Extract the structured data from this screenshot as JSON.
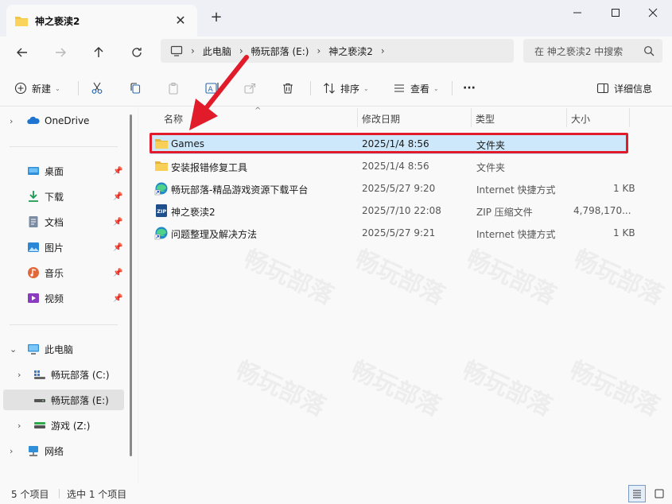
{
  "window": {
    "tab_title": "神之亵渎2",
    "tab_close": "✕",
    "new_tab": "+"
  },
  "navigation": {
    "breadcrumb": [
      "此电脑",
      "畅玩部落 (E:)",
      "神之亵渎2"
    ],
    "search_placeholder": "在 神之亵渎2 中搜索"
  },
  "toolbar": {
    "new_label": "新建",
    "sort_label": "排序",
    "view_label": "查看",
    "more_label": "···",
    "details_label": "详细信息"
  },
  "sidebar": {
    "onedrive": "OneDrive",
    "quick_access": [
      {
        "label": "桌面",
        "icon": "desktop-icon"
      },
      {
        "label": "下载",
        "icon": "download-icon"
      },
      {
        "label": "文档",
        "icon": "document-icon"
      },
      {
        "label": "图片",
        "icon": "pictures-icon"
      },
      {
        "label": "音乐",
        "icon": "music-icon"
      },
      {
        "label": "视频",
        "icon": "video-icon"
      }
    ],
    "this_pc": "此电脑",
    "drives": [
      {
        "label": "畅玩部落 (C:)",
        "icon": "system-drive-icon"
      },
      {
        "label": "畅玩部落 (E:)",
        "icon": "drive-icon"
      },
      {
        "label": "游戏 (Z:)",
        "icon": "drive-icon"
      }
    ],
    "network": "网络"
  },
  "filelist": {
    "columns": {
      "name": "名称",
      "modified": "修改日期",
      "type": "类型",
      "size": "大小"
    },
    "rows": [
      {
        "name": "Games",
        "modified": "2025/1/4 8:56",
        "type": "文件夹",
        "size": "",
        "icon": "folder-icon",
        "selected": true
      },
      {
        "name": "安装报错修复工具",
        "modified": "2025/1/4 8:56",
        "type": "文件夹",
        "size": "",
        "icon": "folder-icon"
      },
      {
        "name": "畅玩部落-精品游戏资源下载平台",
        "modified": "2025/5/27 9:20",
        "type": "Internet 快捷方式",
        "size": "1 KB",
        "icon": "edge-shortcut-icon"
      },
      {
        "name": "神之亵渎2",
        "modified": "2025/7/10 22:08",
        "type": "ZIP 压缩文件",
        "size": "4,798,170...",
        "icon": "zip-icon"
      },
      {
        "name": "问题整理及解决方法",
        "modified": "2025/5/27 9:21",
        "type": "Internet 快捷方式",
        "size": "1 KB",
        "icon": "edge-shortcut-icon"
      }
    ]
  },
  "watermark": "畅玩部落",
  "status": {
    "count": "5 个项目",
    "selected": "选中 1 个项目"
  },
  "colors": {
    "highlight": "#e11b2a",
    "selection": "#cde8fb",
    "folder": "#f4c542"
  }
}
